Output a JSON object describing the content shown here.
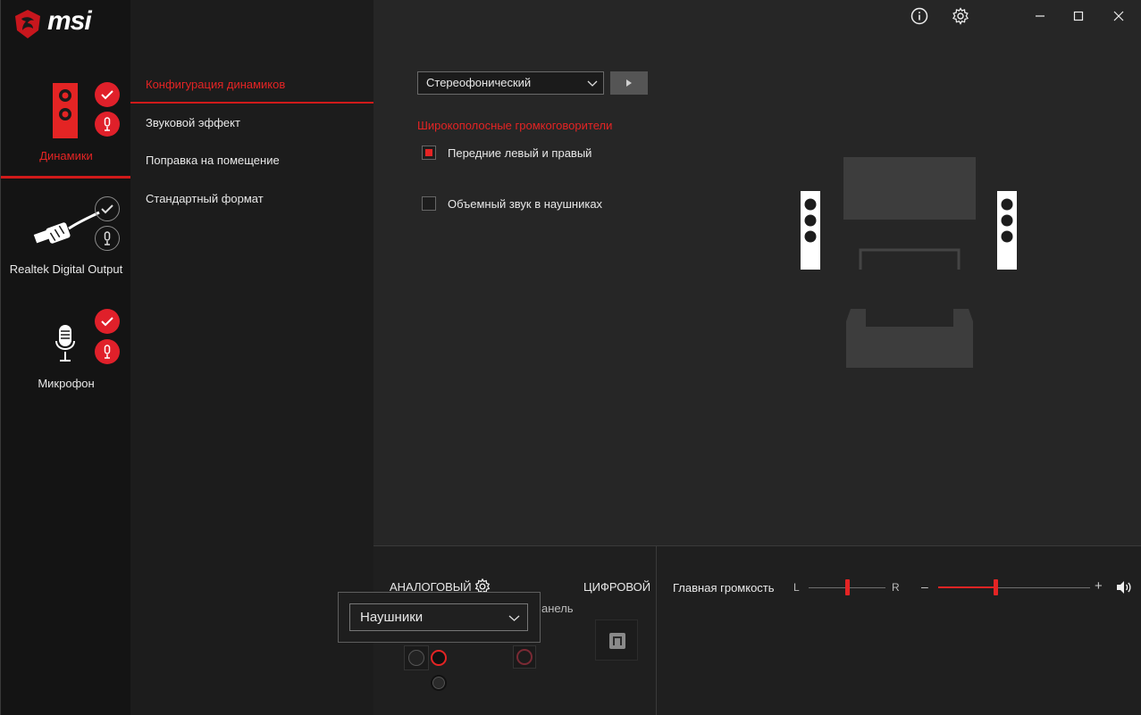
{
  "app": {
    "brand": "msi"
  },
  "devices": [
    {
      "label": "Динамики"
    },
    {
      "label": "Realtek Digital Output"
    },
    {
      "label": "Микрофон"
    }
  ],
  "menu": {
    "items": [
      {
        "label": "Конфигурация динамиков"
      },
      {
        "label": "Звуковой эффект"
      },
      {
        "label": "Поправка на помещение"
      },
      {
        "label": "Стандартный формат"
      }
    ]
  },
  "config": {
    "mode_selected": "Стереофонический",
    "section_title": "Широкополосные громкоговорители",
    "options": [
      {
        "label": "Передние левый и правый",
        "checked": true
      },
      {
        "label": "Объемный звук в наушниках",
        "checked": false
      }
    ]
  },
  "connectors": {
    "analog_label": "АНАЛОГОВЫЙ",
    "digital_label": "ЦИФРОВОЙ",
    "partial_text": "анель",
    "dropdown_selected": "Наушники"
  },
  "volume": {
    "label": "Главная громкость",
    "balance_left": "L",
    "balance_right": "R",
    "minus": "–",
    "plus": "+",
    "balance_level": 0.5,
    "master_level": 0.38
  },
  "colors": {
    "accent": "#e42424",
    "background": "#262626",
    "sidebar": "#141414"
  }
}
